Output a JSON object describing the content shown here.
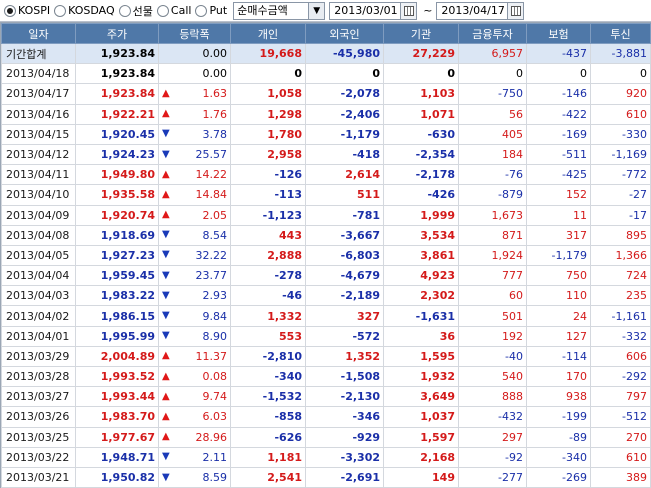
{
  "toolbar": {
    "radios": [
      {
        "label": "KOSPI",
        "checked": true
      },
      {
        "label": "KOSDAQ",
        "checked": false
      },
      {
        "label": "선물",
        "checked": false
      },
      {
        "label": "Call",
        "checked": false
      },
      {
        "label": "Put",
        "checked": false
      }
    ],
    "select_value": "순매수금액",
    "select_arrow": "▼",
    "date_from": "2013/03/01",
    "date_sep": "~",
    "date_to": "2013/04/17"
  },
  "table": {
    "headers": [
      "일자",
      "주가",
      "등락폭",
      "개인",
      "외국인",
      "기관",
      "금융투자",
      "보험",
      "투신"
    ],
    "summary": {
      "date": "기간합계",
      "price": "1,923.84",
      "change": "0.00",
      "individual": "19,668",
      "foreign": "-45,980",
      "institution": "27,229",
      "fininv": "6,957",
      "insurance": "-437",
      "trust": "-3,881"
    },
    "rows": [
      {
        "date": "2013/04/18",
        "price": "1,923.84",
        "dir": "none",
        "change": "0.00",
        "individual": "0",
        "foreign": "0",
        "institution": "0",
        "fininv": "0",
        "insurance": "0",
        "trust": "0"
      },
      {
        "date": "2013/04/17",
        "price": "1,923.84",
        "dir": "up",
        "change": "1.63",
        "individual": "1,058",
        "foreign": "-2,078",
        "institution": "1,103",
        "fininv": "-750",
        "insurance": "-146",
        "trust": "920"
      },
      {
        "date": "2013/04/16",
        "price": "1,922.21",
        "dir": "up",
        "change": "1.76",
        "individual": "1,298",
        "foreign": "-2,406",
        "institution": "1,071",
        "fininv": "56",
        "insurance": "-422",
        "trust": "610"
      },
      {
        "date": "2013/04/15",
        "price": "1,920.45",
        "dir": "down",
        "change": "3.78",
        "individual": "1,780",
        "foreign": "-1,179",
        "institution": "-630",
        "fininv": "405",
        "insurance": "-169",
        "trust": "-330"
      },
      {
        "date": "2013/04/12",
        "price": "1,924.23",
        "dir": "down",
        "change": "25.57",
        "individual": "2,958",
        "foreign": "-418",
        "institution": "-2,354",
        "fininv": "184",
        "insurance": "-511",
        "trust": "-1,169"
      },
      {
        "date": "2013/04/11",
        "price": "1,949.80",
        "dir": "up",
        "change": "14.22",
        "individual": "-126",
        "foreign": "2,614",
        "institution": "-2,178",
        "fininv": "-76",
        "insurance": "-425",
        "trust": "-772"
      },
      {
        "date": "2013/04/10",
        "price": "1,935.58",
        "dir": "up",
        "change": "14.84",
        "individual": "-113",
        "foreign": "511",
        "institution": "-426",
        "fininv": "-879",
        "insurance": "152",
        "trust": "-27"
      },
      {
        "date": "2013/04/09",
        "price": "1,920.74",
        "dir": "up",
        "change": "2.05",
        "individual": "-1,123",
        "foreign": "-781",
        "institution": "1,999",
        "fininv": "1,673",
        "insurance": "11",
        "trust": "-17"
      },
      {
        "date": "2013/04/08",
        "price": "1,918.69",
        "dir": "down",
        "change": "8.54",
        "individual": "443",
        "foreign": "-3,667",
        "institution": "3,534",
        "fininv": "871",
        "insurance": "317",
        "trust": "895"
      },
      {
        "date": "2013/04/05",
        "price": "1,927.23",
        "dir": "down",
        "change": "32.22",
        "individual": "2,888",
        "foreign": "-6,803",
        "institution": "3,861",
        "fininv": "1,924",
        "insurance": "-1,179",
        "trust": "1,366"
      },
      {
        "date": "2013/04/04",
        "price": "1,959.45",
        "dir": "down",
        "change": "23.77",
        "individual": "-278",
        "foreign": "-4,679",
        "institution": "4,923",
        "fininv": "777",
        "insurance": "750",
        "trust": "724"
      },
      {
        "date": "2013/04/03",
        "price": "1,983.22",
        "dir": "down",
        "change": "2.93",
        "individual": "-46",
        "foreign": "-2,189",
        "institution": "2,302",
        "fininv": "60",
        "insurance": "110",
        "trust": "235"
      },
      {
        "date": "2013/04/02",
        "price": "1,986.15",
        "dir": "down",
        "change": "9.84",
        "individual": "1,332",
        "foreign": "327",
        "institution": "-1,631",
        "fininv": "501",
        "insurance": "24",
        "trust": "-1,161"
      },
      {
        "date": "2013/04/01",
        "price": "1,995.99",
        "dir": "down",
        "change": "8.90",
        "individual": "553",
        "foreign": "-572",
        "institution": "36",
        "fininv": "192",
        "insurance": "127",
        "trust": "-332"
      },
      {
        "date": "2013/03/29",
        "price": "2,004.89",
        "dir": "up",
        "change": "11.37",
        "individual": "-2,810",
        "foreign": "1,352",
        "institution": "1,595",
        "fininv": "-40",
        "insurance": "-114",
        "trust": "606"
      },
      {
        "date": "2013/03/28",
        "price": "1,993.52",
        "dir": "up",
        "change": "0.08",
        "individual": "-340",
        "foreign": "-1,508",
        "institution": "1,932",
        "fininv": "540",
        "insurance": "170",
        "trust": "-292"
      },
      {
        "date": "2013/03/27",
        "price": "1,993.44",
        "dir": "up",
        "change": "9.74",
        "individual": "-1,532",
        "foreign": "-2,130",
        "institution": "3,649",
        "fininv": "888",
        "insurance": "938",
        "trust": "797"
      },
      {
        "date": "2013/03/26",
        "price": "1,983.70",
        "dir": "up",
        "change": "6.03",
        "individual": "-858",
        "foreign": "-346",
        "institution": "1,037",
        "fininv": "-432",
        "insurance": "-199",
        "trust": "-512"
      },
      {
        "date": "2013/03/25",
        "price": "1,977.67",
        "dir": "up",
        "change": "28.96",
        "individual": "-626",
        "foreign": "-929",
        "institution": "1,597",
        "fininv": "297",
        "insurance": "-89",
        "trust": "270"
      },
      {
        "date": "2013/03/22",
        "price": "1,948.71",
        "dir": "down",
        "change": "2.11",
        "individual": "1,181",
        "foreign": "-3,302",
        "institution": "2,168",
        "fininv": "-92",
        "insurance": "-340",
        "trust": "610"
      },
      {
        "date": "2013/03/21",
        "price": "1,950.82",
        "dir": "down",
        "change": "8.59",
        "individual": "2,541",
        "foreign": "-2,691",
        "institution": "149",
        "fininv": "-277",
        "insurance": "-269",
        "trust": "389"
      }
    ]
  },
  "colors": {
    "up": "#d41a1a",
    "down": "#1a2fa8",
    "header_bg": "#4f78a8",
    "summary_bg": "#dbe6f4"
  }
}
